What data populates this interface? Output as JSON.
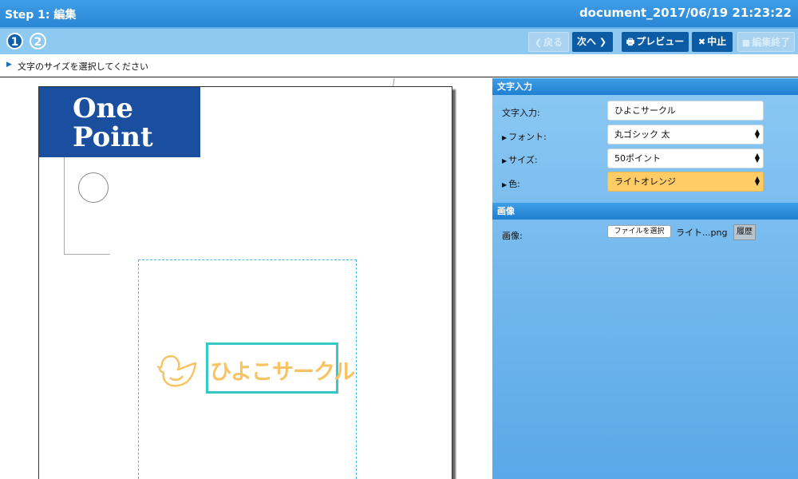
{
  "header": {
    "step_title": "Step 1: 編集",
    "document": "document_2017/06/19 21:23:22"
  },
  "steps": [
    "1",
    "2"
  ],
  "toolbar": {
    "back_label": "戻る",
    "back_icon": "chevron-left-icon",
    "next_label": "次へ",
    "next_icon": "chevron-right-icon",
    "preview_label": "プレビュー",
    "preview_icon": "printer-icon",
    "cancel_label": "中止",
    "cancel_icon": "close-icon",
    "finish_label": "編集終了",
    "finish_icon": "stop-icon"
  },
  "instruction": "文字のサイズを選択してください",
  "canvas": {
    "logo_line1": "One",
    "logo_line2": "Point",
    "text_object": "ひよこサークル",
    "text_color": "#f8c463",
    "selection_color": "#36c7c7"
  },
  "text_section": {
    "title": "文字入力",
    "input_label": "文字入力:",
    "input_value": "ひよこサークル",
    "font_label": "フォント:",
    "font_value": "丸ゴシック 太",
    "size_label": "サイズ:",
    "size_value": "50ポイント",
    "color_label": "色:",
    "color_value": "ライトオレンジ"
  },
  "image_section": {
    "title": "画像",
    "label": "画像:",
    "file_button": "ファイルを選択",
    "file_name": "ライト...png",
    "history_button": "履歴"
  },
  "colors": {
    "accent": "#2a86d6",
    "toolbar": "#8ec9f2",
    "button": "#0c5ca5",
    "orange_select": "#ffcc66"
  }
}
